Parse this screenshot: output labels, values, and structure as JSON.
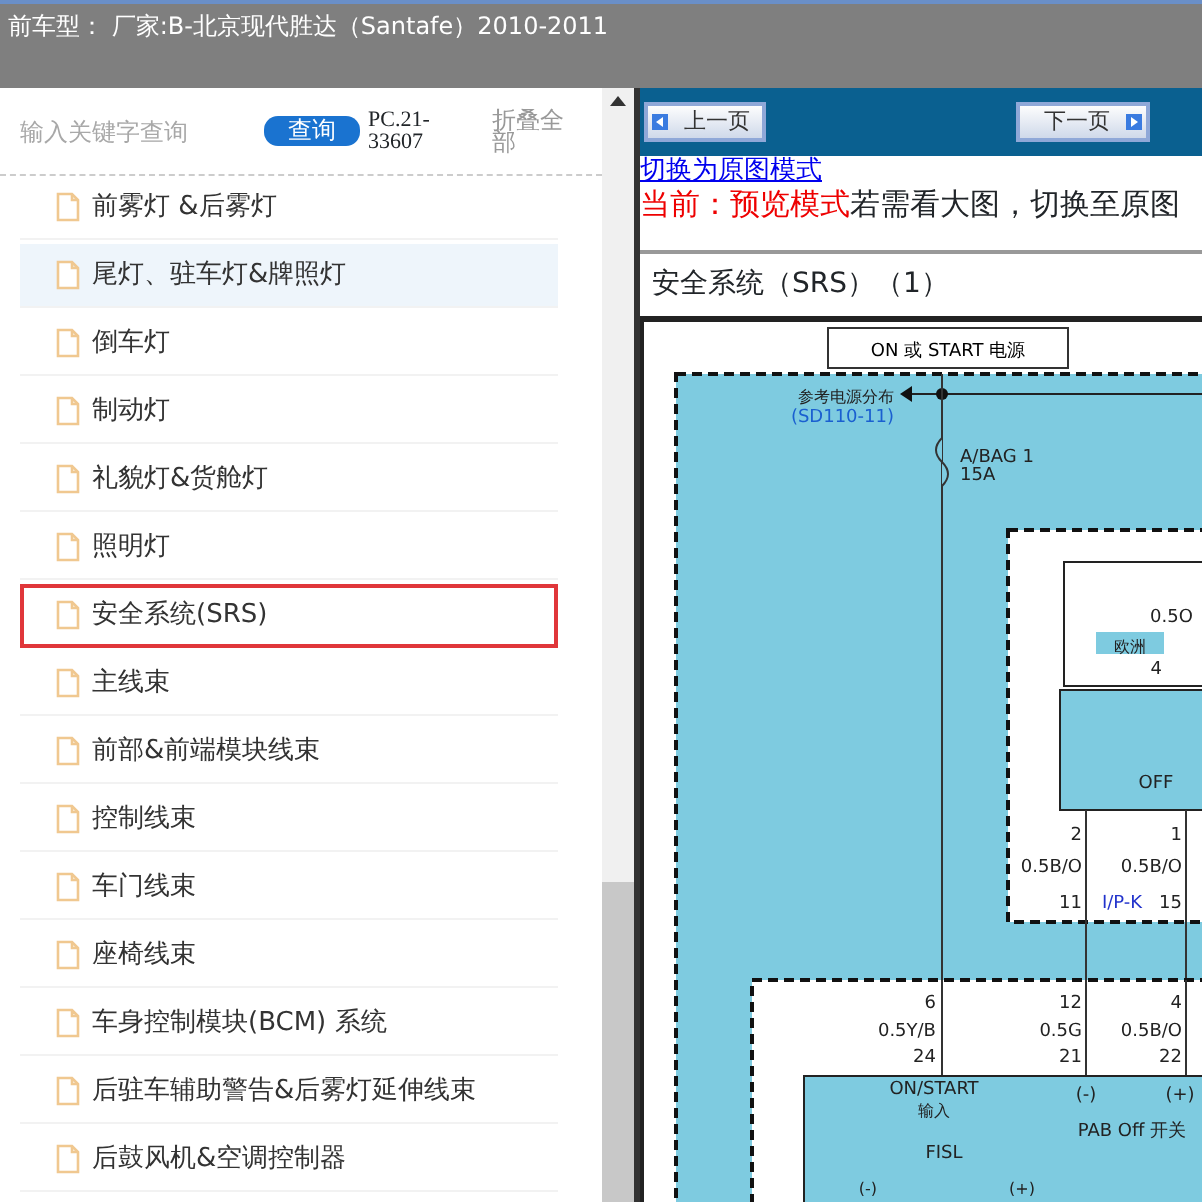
{
  "header": {
    "title": "前车型： 厂家:B-北京现代胜达（Santafe）2010-2011"
  },
  "sidebar": {
    "search": {
      "placeholder": "输入关键字查询"
    },
    "search_button": "查询",
    "code": "PC.21-33607",
    "collapse_all": "折叠全部",
    "items": [
      {
        "label": "前雾灯 &后雾灯",
        "selected": false,
        "hovered": false
      },
      {
        "label": "尾灯、驻车灯&牌照灯",
        "selected": false,
        "hovered": true
      },
      {
        "label": "倒车灯",
        "selected": false,
        "hovered": false
      },
      {
        "label": "制动灯",
        "selected": false,
        "hovered": false
      },
      {
        "label": "礼貌灯&货舱灯",
        "selected": false,
        "hovered": false
      },
      {
        "label": "照明灯",
        "selected": false,
        "hovered": false
      },
      {
        "label": "安全系统(SRS)",
        "selected": true,
        "hovered": false
      },
      {
        "label": "主线束",
        "selected": false,
        "hovered": false
      },
      {
        "label": "前部&前端模块线束",
        "selected": false,
        "hovered": false
      },
      {
        "label": "控制线束",
        "selected": false,
        "hovered": false
      },
      {
        "label": "车门线束",
        "selected": false,
        "hovered": false
      },
      {
        "label": "座椅线束",
        "selected": false,
        "hovered": false
      },
      {
        "label": "车身控制模块(BCM) 系统",
        "selected": false,
        "hovered": false
      },
      {
        "label": "后驻车辅助警告&后雾灯延伸线束",
        "selected": false,
        "hovered": false
      },
      {
        "label": "后鼓风机&空调控制器",
        "selected": false,
        "hovered": false
      }
    ]
  },
  "viewer": {
    "prev_button": "上一页",
    "next_button": "下一页",
    "mode_link": "切换为原图模式",
    "mode_status": "当前：预览模式",
    "mode_hint": "若需看大图，切换至原图",
    "page_title": "安全系统（SRS）（1）",
    "diagram": {
      "labels": [
        "ON 或 START 电源",
        "参考电源分布",
        "(SD110-11)",
        "A/BAG 1",
        "15A",
        "0.5O",
        "欧洲",
        "4",
        "OFF",
        "2",
        "1",
        "0.5B/O",
        "0.5B/O",
        "11",
        "I/P-K",
        "15",
        "6",
        "12",
        "4",
        "0.5Y/B",
        "0.5G",
        "0.5B/O",
        "24",
        "21",
        "22",
        "ON/START",
        "输入",
        "(-)",
        "(+)",
        "PAB Off 开关",
        "FISL",
        "(-)",
        "(+)"
      ]
    }
  }
}
